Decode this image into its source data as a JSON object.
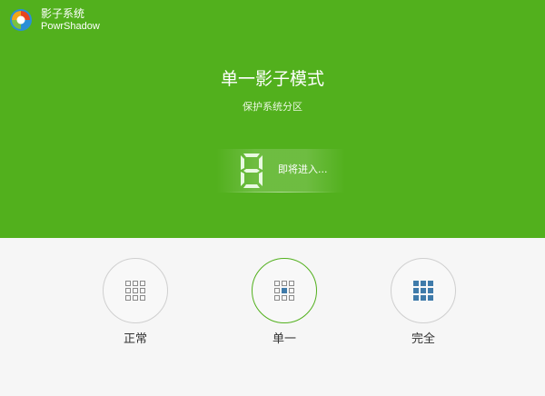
{
  "brand": {
    "name_cn": "影子系统",
    "name_en": "PowrShadow"
  },
  "hero": {
    "title": "单一影子模式",
    "subtitle": "保护系统分区",
    "status_digit": "8",
    "status_text": "即将进入..."
  },
  "modes": [
    {
      "label": "正常",
      "icon": "grid-outline-icon",
      "active": false
    },
    {
      "label": "单一",
      "icon": "grid-center-filled-icon",
      "active": true
    },
    {
      "label": "完全",
      "icon": "grid-filled-icon",
      "active": false
    }
  ],
  "colors": {
    "accent_green": "#52b01d",
    "icon_gray": "#8a8a8a",
    "icon_blue": "#3f7baa"
  }
}
